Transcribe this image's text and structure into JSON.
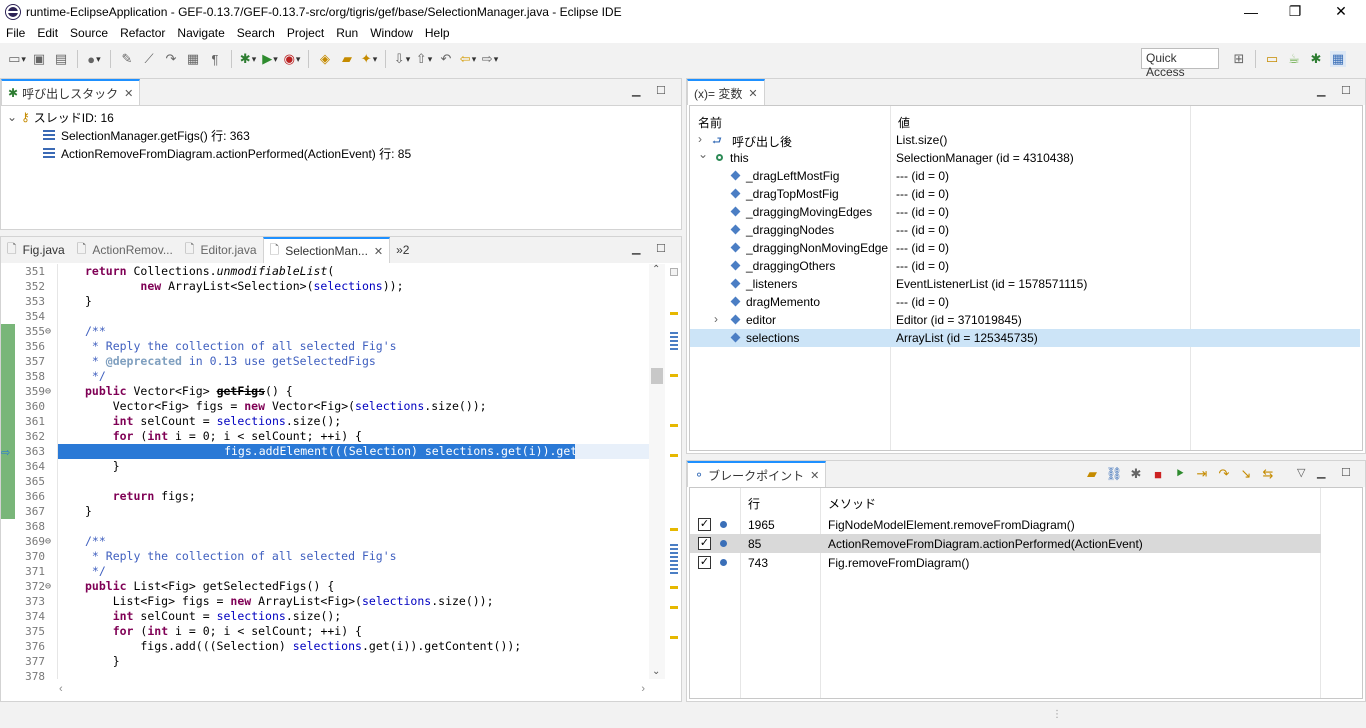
{
  "window": {
    "title": "runtime-EclipseApplication - GEF-0.13.7/GEF-0.13.7-src/org/tigris/gef/base/SelectionManager.java - Eclipse IDE",
    "controls": {
      "minimize": "—",
      "restore": "❐",
      "close": "✕"
    }
  },
  "menu": [
    "File",
    "Edit",
    "Source",
    "Refactor",
    "Navigate",
    "Search",
    "Project",
    "Run",
    "Window",
    "Help"
  ],
  "toolbar": {
    "quick_access": "Quick Access",
    "icons": [
      "new-icon",
      "save-icon",
      "save-all-icon",
      "team-icon",
      "bug-icon",
      "run-icon",
      "coverage-icon",
      "external-tools-icon",
      "open-type-icon",
      "search-icon",
      "back-icon",
      "forward-icon",
      "perspective-icon",
      "debug-perspective-icon"
    ]
  },
  "callstack": {
    "tab_label": "呼び出しスタック",
    "thread": "スレッドID: 16",
    "frames": [
      "SelectionManager.getFigs() 行: 363",
      "ActionRemoveFromDiagram.actionPerformed(ActionEvent) 行: 85"
    ]
  },
  "editor": {
    "tabs": [
      {
        "label": "Fig.java",
        "active": false
      },
      {
        "label": "ActionRemov...",
        "active": false
      },
      {
        "label": "Editor.java",
        "active": false
      },
      {
        "label": "SelectionMan...",
        "active": true
      }
    ],
    "overflow": "»2",
    "current_line": 363,
    "lines": [
      {
        "n": "351",
        "text": "        return Collections.unmodifiableList("
      },
      {
        "n": "352",
        "text": "                new ArrayList<Selection>(selections));"
      },
      {
        "n": "353",
        "text": "    }"
      },
      {
        "n": "354",
        "text": ""
      },
      {
        "n": "355",
        "text": "    /**"
      },
      {
        "n": "356",
        "text": "     * Reply the collection of all selected Fig's"
      },
      {
        "n": "357",
        "text": "     * @deprecated in 0.13 use getSelectedFigs"
      },
      {
        "n": "358",
        "text": "     */"
      },
      {
        "n": "359",
        "text": "    public Vector<Fig> getFigs() {"
      },
      {
        "n": "360",
        "text": "        Vector<Fig> figs = new Vector<Fig>(selections.size());"
      },
      {
        "n": "361",
        "text": "        int selCount = selections.size();"
      },
      {
        "n": "362",
        "text": "        for (int i = 0; i < selCount; ++i) {"
      },
      {
        "n": "363",
        "text": "            figs.addElement(((Selection) selections.get(i)).getContent());"
      },
      {
        "n": "364",
        "text": "        }"
      },
      {
        "n": "365",
        "text": ""
      },
      {
        "n": "366",
        "text": "        return figs;"
      },
      {
        "n": "367",
        "text": "    }"
      },
      {
        "n": "368",
        "text": ""
      },
      {
        "n": "369",
        "text": "    /**"
      },
      {
        "n": "370",
        "text": "     * Reply the collection of all selected Fig's"
      },
      {
        "n": "371",
        "text": "     */"
      },
      {
        "n": "372",
        "text": "    public List<Fig> getSelectedFigs() {"
      },
      {
        "n": "373",
        "text": "        List<Fig> figs = new ArrayList<Fig>(selections.size());"
      },
      {
        "n": "374",
        "text": "        int selCount = selections.size();"
      },
      {
        "n": "375",
        "text": "        for (int i = 0; i < selCount; ++i) {"
      },
      {
        "n": "376",
        "text": "            figs.add(((Selection) selections.get(i)).getContent());"
      },
      {
        "n": "377",
        "text": "        }"
      },
      {
        "n": "378",
        "text": ""
      }
    ]
  },
  "variables": {
    "tab_label": "(x)= 変数",
    "col_name": "名前",
    "col_value": "値",
    "rows": [
      {
        "name": "呼び出し後",
        "value": "List.size()",
        "kind": "return",
        "expand": "›"
      },
      {
        "name": "this",
        "value": "SelectionManager (id = 4310438)",
        "kind": "this",
        "expand": "⌄"
      },
      {
        "name": "_dragLeftMostFig",
        "value": "--- (id = 0)",
        "kind": "field",
        "expand": ""
      },
      {
        "name": "_dragTopMostFig",
        "value": "--- (id = 0)",
        "kind": "field",
        "expand": ""
      },
      {
        "name": "_draggingMovingEdges",
        "value": "--- (id = 0)",
        "kind": "field",
        "expand": ""
      },
      {
        "name": "_draggingNodes",
        "value": "--- (id = 0)",
        "kind": "field",
        "expand": ""
      },
      {
        "name": "_draggingNonMovingEdge",
        "value": "--- (id = 0)",
        "kind": "field",
        "expand": ""
      },
      {
        "name": "_draggingOthers",
        "value": "--- (id = 0)",
        "kind": "field",
        "expand": ""
      },
      {
        "name": "_listeners",
        "value": "EventListenerList (id = 1578571115)",
        "kind": "field",
        "expand": ""
      },
      {
        "name": "dragMemento",
        "value": "--- (id = 0)",
        "kind": "field",
        "expand": ""
      },
      {
        "name": "editor",
        "value": "Editor (id = 371019845)",
        "kind": "field",
        "expand": "›"
      },
      {
        "name": "selections",
        "value": "ArrayList (id = 125345735)",
        "kind": "field",
        "expand": "",
        "selected": true
      }
    ]
  },
  "breakpoints": {
    "tab_label": "ブレークポイント",
    "col_line": "行",
    "col_method": "メソッド",
    "rows": [
      {
        "line": "1965",
        "method": "FigNodeModelElement.removeFromDiagram()",
        "checked": "✓"
      },
      {
        "line": "85",
        "method": "ActionRemoveFromDiagram.actionPerformed(ActionEvent)",
        "checked": "✓",
        "selected": true
      },
      {
        "line": "743",
        "method": "Fig.removeFromDiagram()",
        "checked": "✓"
      }
    ]
  }
}
